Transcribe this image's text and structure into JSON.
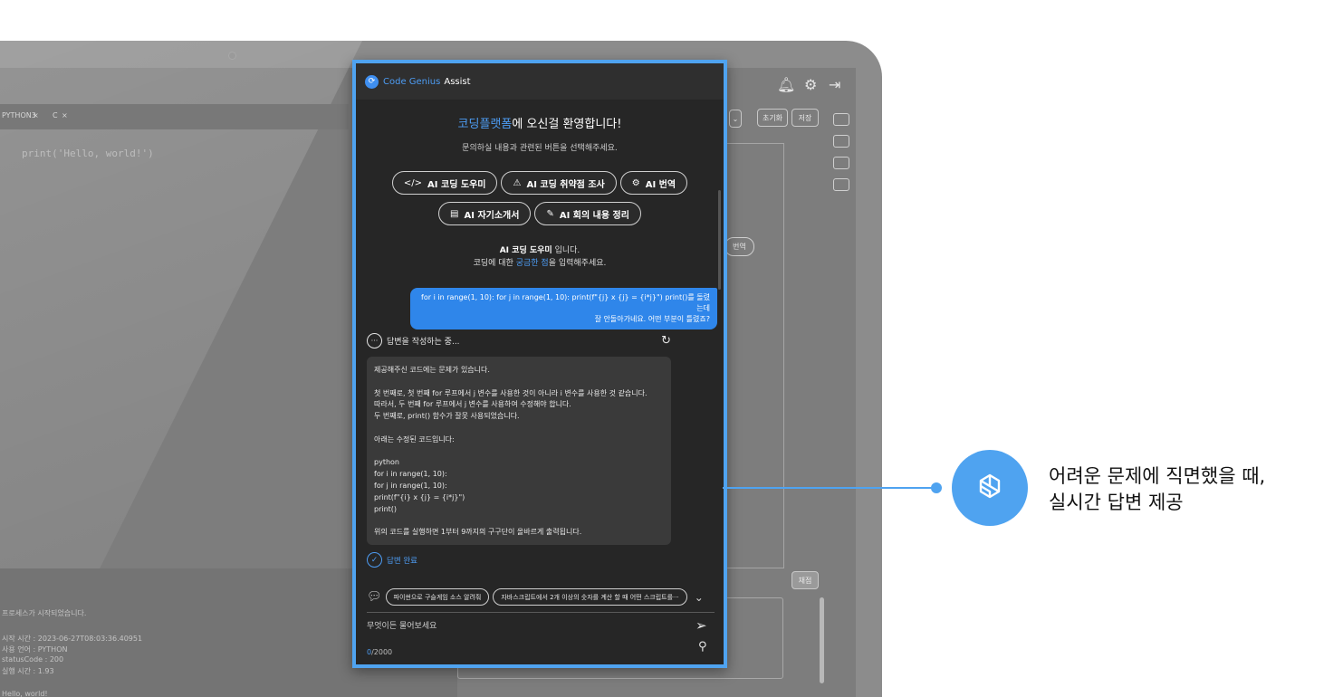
{
  "background": {
    "tabs": [
      "PYTHON3",
      "C"
    ],
    "code_line": "print('Hello, world!')",
    "buttons": [
      "초기화",
      "저장"
    ],
    "side_pill": "번역",
    "run_button": "채점",
    "console_lines": [
      "프로세스가 시작되었습니다.",
      "시작 시간 : 2023-06-27T08:03:36.40951",
      "사용 언어 : PYTHON",
      "statusCode : 200",
      "실행 시간 : 1.93",
      "Hello, world!"
    ]
  },
  "assist": {
    "brand": "Code Genius",
    "brand_suffix": "Assist",
    "welcome_highlight": "코딩플랫폼",
    "welcome_rest": "에 오신걸 환영합니다!",
    "welcome_sub": "문의하실 내용과 관련된 버튼을 선택해주세요.",
    "buttons_row1": [
      {
        "icon": "</>",
        "label": "AI 코딩 도우미"
      },
      {
        "icon": "⚠",
        "label": "AI 코딩 취약점 조사"
      },
      {
        "icon": "⚙",
        "label": "AI 번역"
      }
    ],
    "buttons_row2": [
      {
        "icon": "▤",
        "label": "AI 자기소개서"
      },
      {
        "icon": "✎",
        "label": "AI 회의 내용 정리"
      }
    ],
    "mode_name": "AI 코딩 도우미",
    "mode_suffix": " 입니다.",
    "mode_prompt_pre": "코딩에 대한 ",
    "mode_prompt_hl": "궁금한 점",
    "mode_prompt_post": "을 입력해주세요.",
    "user_message_line1": "for i in range(1, 10): for j in range(1, 10): print(f\"{j} x {j} = {i*j}\") print()를 돌렸는데",
    "user_message_line2": "잘 안돌아가네요. 어떤 부분이 틀렸죠?",
    "status": "답변을 작성하는 중...",
    "answer": "제공해주신 코드에는 문제가 있습니다.\n\n첫 번째로, 첫 번째 for 루프에서 j 변수를 사용한 것이 아니라 i 변수를 사용한 것 같습니다.\n따라서, 두 번째 for 루프에서 j 변수를 사용하여 수정해야 합니다.\n두 번째로, print() 함수가 잘못 사용되었습니다.\n\n아래는 수정된 코드입니다:\n\npython\nfor i in range(1, 10):\nfor j in range(1, 10):\nprint(f\"{i} x {j} = {i*j}\")\nprint()\n\n위의 코드를 실행하면 1부터 9까지의 구구단이 올바르게 출력됩니다.",
    "done": "답변 완료",
    "suggestions": [
      "파이썬으로 구슬게임 소스 알려줘",
      "자바스크립트에서 2개 이상의 숫자를 계산 할 때 어떤 스크립트를···"
    ],
    "input_placeholder": "무엇이든 물어보세요",
    "counter_current": "0",
    "counter_max": "/2000"
  },
  "callout": {
    "line1": "어려운 문제에 직면했을 때,",
    "line2": "실시간 답변 제공"
  },
  "colors": {
    "accent": "#4fa3f0",
    "panel_bg": "#262626",
    "user_bubble": "#2f86ea"
  }
}
